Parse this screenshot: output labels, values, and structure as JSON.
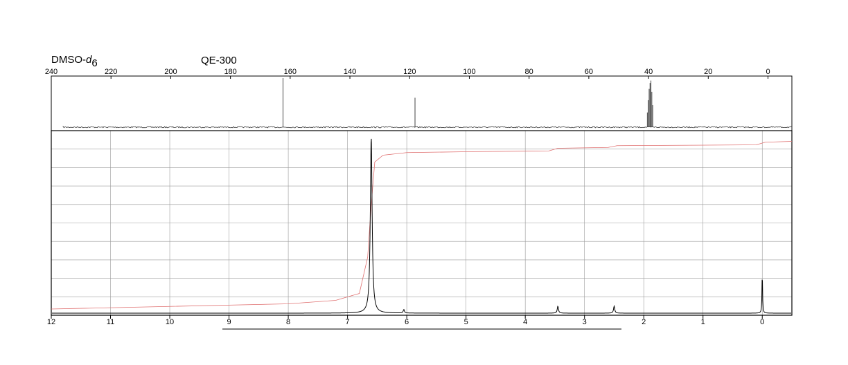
{
  "header": {
    "solvent_base": "DMSO-",
    "solvent_italic": "d",
    "solvent_sub": "6",
    "instrument": "QE-300"
  },
  "chart_data": [
    {
      "type": "line",
      "name": "13C spectrum",
      "xlim": [
        240,
        -8
      ],
      "x_ticks": [
        240,
        220,
        200,
        180,
        160,
        140,
        120,
        100,
        80,
        60,
        40,
        20,
        0
      ],
      "x_tick_labels": [
        "240",
        "220",
        "200",
        "180",
        "160",
        "140",
        "120",
        "100",
        "80",
        "60",
        "40",
        "20",
        "0"
      ],
      "grid": false,
      "data_start": 236,
      "peaks": [
        {
          "x": 162.4,
          "height": 1.0
        },
        {
          "x": 118.2,
          "height": 0.6
        },
        {
          "x": 39.5,
          "height": 0.9
        },
        {
          "x": 39.2,
          "height": 0.95
        },
        {
          "x": 39.8,
          "height": 0.78
        },
        {
          "x": 38.9,
          "height": 0.72
        },
        {
          "x": 40.1,
          "height": 0.55
        },
        {
          "x": 38.6,
          "height": 0.45
        },
        {
          "x": 40.4,
          "height": 0.3
        }
      ]
    },
    {
      "type": "line",
      "name": "1H spectrum",
      "xlim": [
        12,
        -0.5
      ],
      "x_ticks": [
        12,
        11,
        10,
        9,
        8,
        7,
        6,
        5,
        4,
        3,
        2,
        1,
        0
      ],
      "x_tick_labels": [
        "12",
        "11",
        "10",
        "9",
        "8",
        "7",
        "6",
        "5",
        "4",
        "3",
        "2",
        "1",
        "0"
      ],
      "grid": true,
      "peaks": [
        {
          "x": 6.6,
          "height": 1.0
        },
        {
          "x": 6.05,
          "height": 0.02
        },
        {
          "x": 3.45,
          "height": 0.04
        },
        {
          "x": 2.5,
          "height": 0.04
        },
        {
          "x": 0.0,
          "height": 0.23
        }
      ],
      "integral": [
        [
          12,
          0.0
        ],
        [
          10,
          0.015
        ],
        [
          8,
          0.03
        ],
        [
          7.2,
          0.05
        ],
        [
          6.8,
          0.09
        ],
        [
          6.66,
          0.3
        ],
        [
          6.6,
          0.6
        ],
        [
          6.54,
          0.85
        ],
        [
          6.4,
          0.89
        ],
        [
          6.0,
          0.905
        ],
        [
          5.0,
          0.91
        ],
        [
          3.6,
          0.915
        ],
        [
          3.45,
          0.93
        ],
        [
          2.6,
          0.935
        ],
        [
          2.45,
          0.945
        ],
        [
          0.1,
          0.95
        ],
        [
          -0.05,
          0.965
        ],
        [
          -0.5,
          0.97
        ]
      ],
      "colors": {
        "spectrum": "#000000",
        "integral": "#e07070",
        "grid": "#9a9a9a"
      }
    }
  ]
}
